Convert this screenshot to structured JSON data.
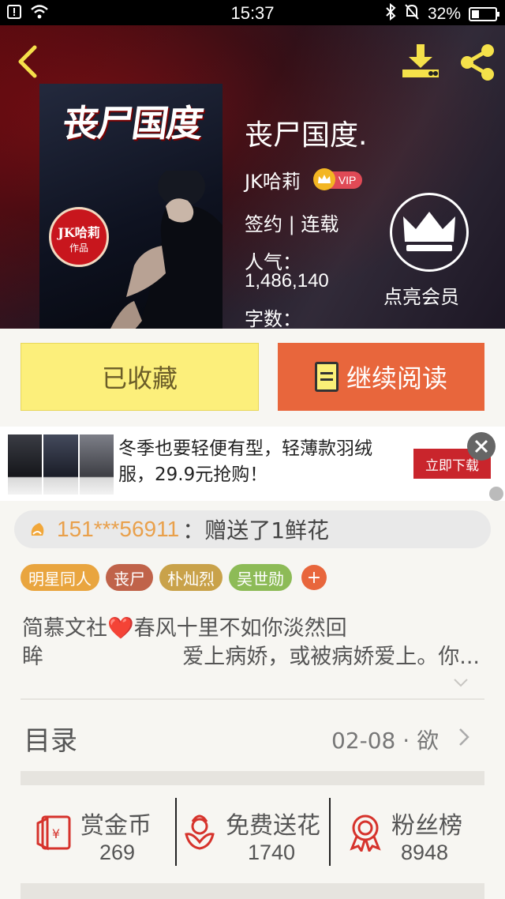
{
  "status_bar": {
    "time": "15:37",
    "battery": "32%",
    "battery_level": 0.32
  },
  "book": {
    "cover_title": "丧尸国度",
    "cover_seal_author": "JK哈莉",
    "cover_seal_sub": "作品",
    "title": "丧尸国度.",
    "author": "JK哈莉",
    "vip_label": "VIP",
    "status": "签约 | 连载",
    "popularity_label": "人气：",
    "popularity_value": "1,486,140",
    "words_label": "字数：",
    "member_label": "点亮会员"
  },
  "actions": {
    "favorite_label": "已收藏",
    "read_label": "继续阅读"
  },
  "ad": {
    "text": "冬季也要轻便有型，轻薄款羽绒服，29.9元抢购！",
    "cta": "立即下载"
  },
  "gift": {
    "user": "151***56911",
    "message": "：赠送了1鲜花"
  },
  "tags": [
    {
      "label": "明星同人",
      "color": "#e9a53f"
    },
    {
      "label": "丧尸",
      "color": "#c0634a"
    },
    {
      "label": "朴灿烈",
      "color": "#c9a24a"
    },
    {
      "label": "吴世勋",
      "color": "#8dbb57"
    }
  ],
  "tag_add": "+",
  "intro": {
    "line1": "简慕文社❤️春风十里不如你淡然回",
    "line2_left": "眸",
    "line2_right": "爱上病娇，或被病娇爱上。你..."
  },
  "catalog": {
    "title": "目录",
    "latest": "02-08 · 欲"
  },
  "stats": [
    {
      "label": "赏金币",
      "value": "269",
      "icon": "red-envelope-icon"
    },
    {
      "label": "免费送花",
      "value": "1740",
      "icon": "flower-icon"
    },
    {
      "label": "粉丝榜",
      "value": "8948",
      "icon": "medal-icon"
    }
  ],
  "colors": {
    "accent_orange": "#e8663c",
    "fav_yellow": "#fcef7b",
    "icon_red": "#d6332c"
  }
}
